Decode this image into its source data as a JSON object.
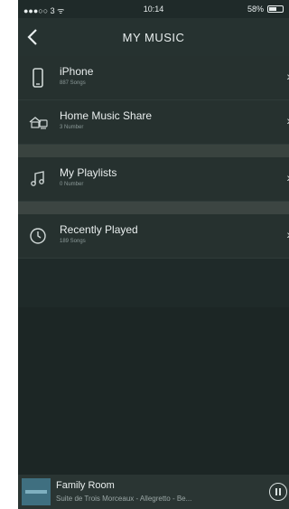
{
  "status_bar": {
    "carrier": "●●●○○ 3 ᯤ",
    "time": "10:14",
    "battery": "58%",
    "battery_level": 0.58
  },
  "nav": {
    "title": "MY MUSIC",
    "back_icon": "chevron-left-icon"
  },
  "list": {
    "items": [
      {
        "title": "iPhone",
        "subtitle": "887 Songs",
        "icon": "phone-icon"
      },
      {
        "title": "Home Music Share",
        "subtitle": "3 Number",
        "icon": "home-share-icon"
      },
      {
        "title": "My Playlists",
        "subtitle": "0 Number",
        "icon": "music-note-icon"
      },
      {
        "title": "Recently Played",
        "subtitle": "189 Songs",
        "icon": "clock-icon"
      }
    ]
  },
  "player": {
    "room": "Family Room",
    "track": "Suite de Trois Morceaux - Allegretto - Be...",
    "pause_icon": "pause-icon"
  }
}
